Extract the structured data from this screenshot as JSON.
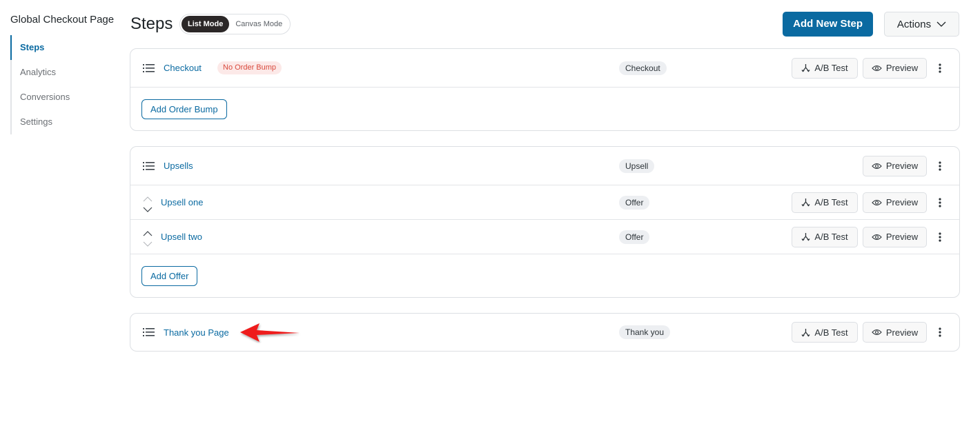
{
  "sidebar": {
    "title": "Global Checkout Page",
    "items": [
      {
        "label": "Steps",
        "active": true
      },
      {
        "label": "Analytics",
        "active": false
      },
      {
        "label": "Conversions",
        "active": false
      },
      {
        "label": "Settings",
        "active": false
      }
    ]
  },
  "header": {
    "title": "Steps",
    "modes": [
      {
        "label": "List Mode",
        "active": true
      },
      {
        "label": "Canvas Mode",
        "active": false
      }
    ],
    "add_step_label": "Add New Step",
    "actions_label": "Actions",
    "actions_icon": "chevron-down-icon"
  },
  "buttons": {
    "ab_test_label": "A/B Test",
    "ab_test_icon": "split-arrows-icon",
    "preview_label": "Preview",
    "preview_icon": "eye-icon",
    "more_icon": "kebab-menu-icon"
  },
  "groups": [
    {
      "name": "Checkout",
      "badge": "No Order Bump",
      "type": "Checkout",
      "has_ab_test": true,
      "footer_button": "Add Order Bump"
    },
    {
      "name": "Upsells",
      "type": "Upsell",
      "has_ab_test": false,
      "offers": [
        {
          "name": "Upsell one",
          "type": "Offer"
        },
        {
          "name": "Upsell two",
          "type": "Offer"
        }
      ],
      "footer_button": "Add Offer"
    },
    {
      "name": "Thank you Page",
      "type": "Thank you",
      "has_ab_test": true
    }
  ],
  "colors": {
    "accent": "#0a6aa1",
    "warning_text": "#d94a3d",
    "warning_bg": "#fce9e8",
    "annotation_arrow": "#ee1c1c"
  }
}
